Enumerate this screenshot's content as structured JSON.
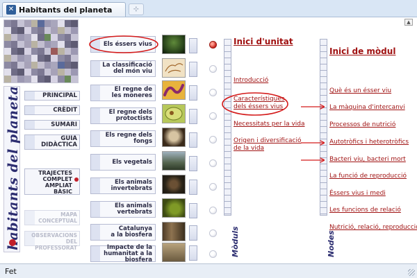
{
  "window": {
    "tab_title": "Habitants del planeta",
    "new_tab_symbol": "⊹",
    "status": "Fet"
  },
  "left_panel": {
    "logo_text": "habitants del planeta",
    "buttons": [
      {
        "label": "PRINCIPAL",
        "enabled": true
      },
      {
        "label": "CRÈDIT",
        "enabled": true
      },
      {
        "label": "SUMARI",
        "enabled": true
      },
      {
        "label": "GUIA\nDIDÀCTICA",
        "enabled": true
      }
    ],
    "trajectes": [
      "TRAJECTES",
      "COMPLET",
      "AMPLIAT",
      "BÀSIC"
    ],
    "disabled_buttons": [
      {
        "label": "MAPA\nCONCEPTUAL"
      },
      {
        "label": "OBSERVACIONS\nDEL PROFESSORAT"
      }
    ]
  },
  "topics": [
    {
      "label": "Els éssers vius",
      "thumb": "plant",
      "selected": true
    },
    {
      "label": "La classificació\ndel món viu",
      "thumb": "sketch",
      "selected": false
    },
    {
      "label": "El regne de\nles moneres",
      "thumb": "bacteria",
      "selected": false
    },
    {
      "label": "El regne dels\nprotoctists",
      "thumb": "cell",
      "selected": false
    },
    {
      "label": "Els regne dels fongs",
      "thumb": "mushroom",
      "selected": false
    },
    {
      "label": "Els vegetals",
      "thumb": "tree",
      "selected": false
    },
    {
      "label": "Els animals\ninvertebrats",
      "thumb": "spider",
      "selected": false
    },
    {
      "label": "Els animals\nvertebrats",
      "thumb": "frog",
      "selected": false
    },
    {
      "label": "Catalunya\na la biosfera",
      "thumb": "forest",
      "selected": false
    },
    {
      "label": "Impacte de la\nhumanitat a la biosfera",
      "thumb": "people",
      "selected": false
    }
  ],
  "modules": {
    "strip_label": "Mòduls",
    "heading": "Inici d'unitat",
    "links": [
      "Introducció",
      "Característiques\ndels éssers vius",
      "Necessitats per la vida",
      "Origen i diversificació\nde la vida"
    ]
  },
  "nodes": {
    "strip_label": "Nodes",
    "heading": "Inici de mòdul",
    "links": [
      "Què és un ésser viu",
      "La màquina d'intercanvi",
      "Processos de nutrició",
      "Autotròfics i heterotròfics",
      "Bacteri viu, bacteri mort",
      "La funció de reproducció",
      "Éssers vius i medi",
      "Les funcions de relació",
      "Nutrició, relació, reproducció"
    ]
  },
  "colors": {
    "link": "#a01212",
    "accent_navy": "#2c2d70",
    "annotation_red": "#d41a1a"
  }
}
